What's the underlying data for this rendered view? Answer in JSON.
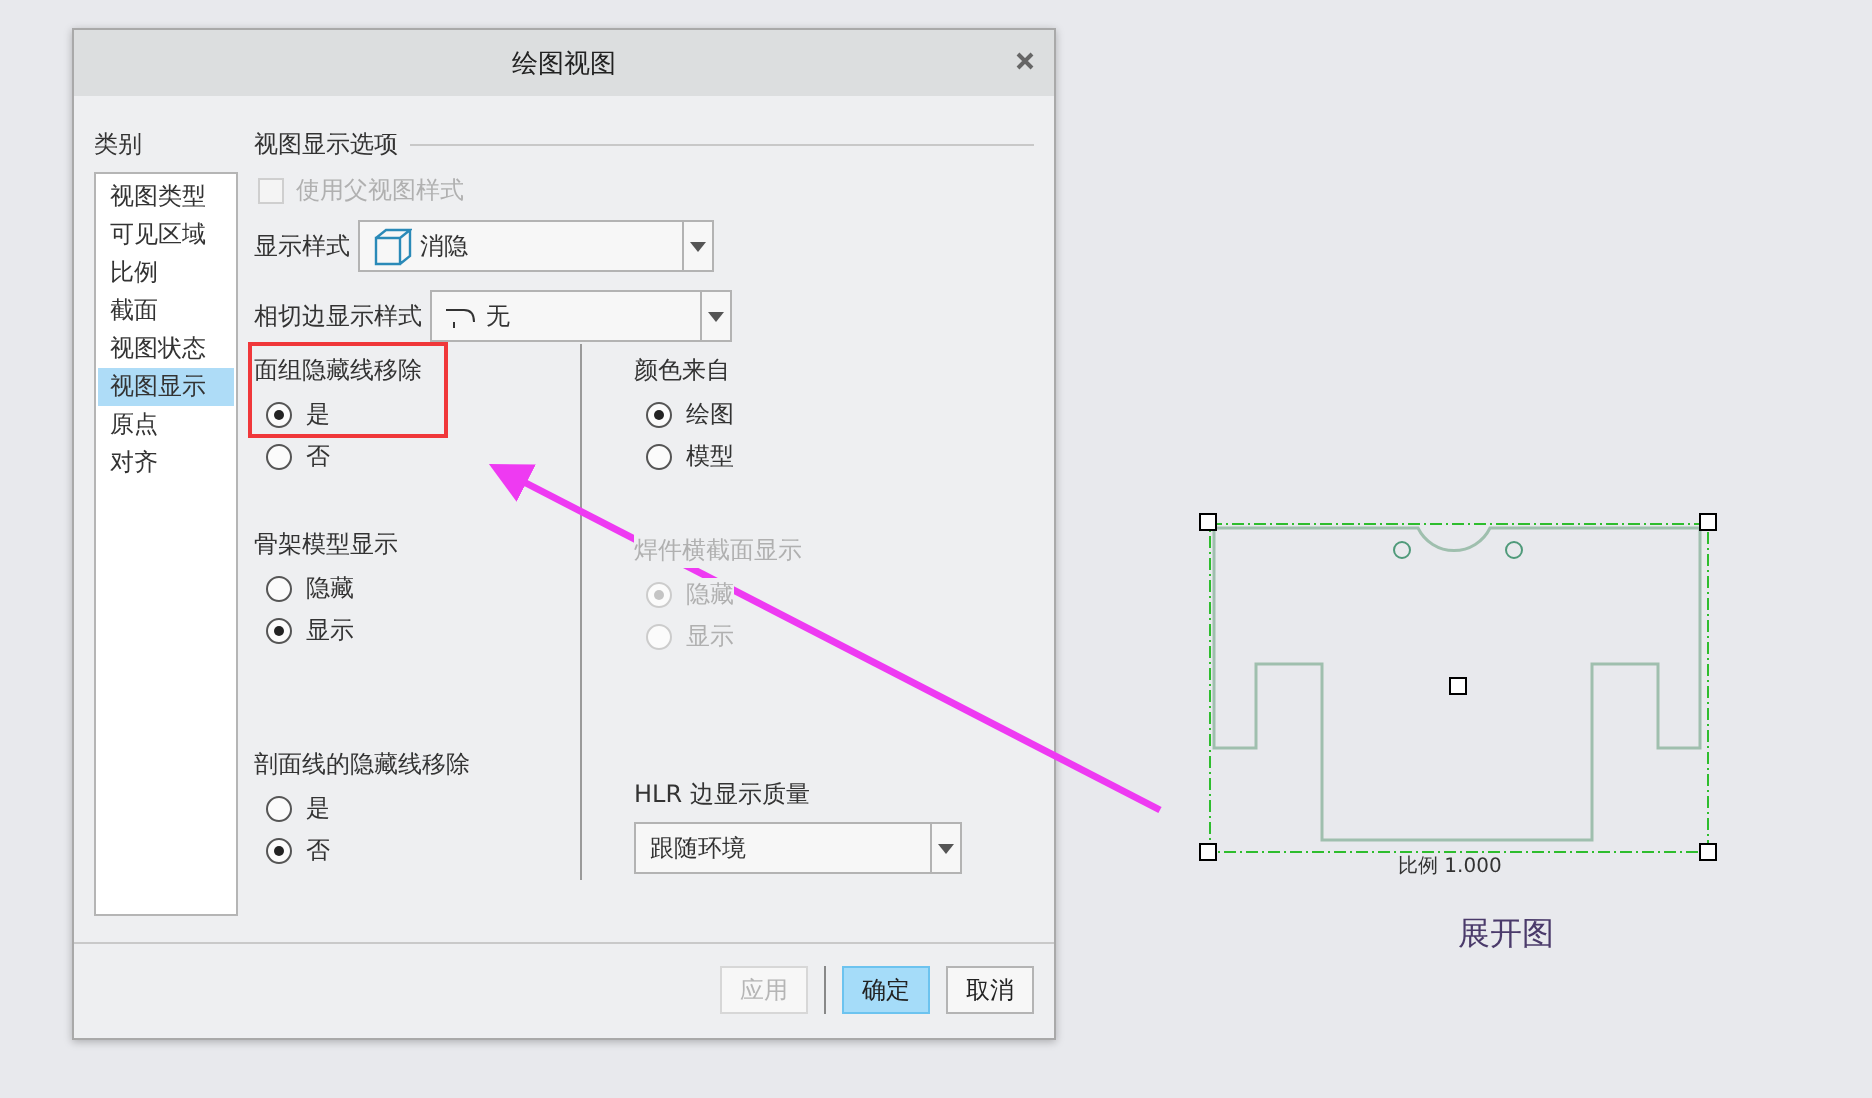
{
  "window": {
    "title": "绘图视图"
  },
  "categories": {
    "title": "类别",
    "items": [
      {
        "label": "视图类型",
        "selected": false
      },
      {
        "label": "可见区域",
        "selected": false
      },
      {
        "label": "比例",
        "selected": false
      },
      {
        "label": "截面",
        "selected": false
      },
      {
        "label": "视图状态",
        "selected": false
      },
      {
        "label": "视图显示",
        "selected": true
      },
      {
        "label": "原点",
        "selected": false
      },
      {
        "label": "对齐",
        "selected": false
      }
    ]
  },
  "options": {
    "title": "视图显示选项",
    "parent_style": {
      "label": "使用父视图样式",
      "checked": false,
      "disabled": true
    },
    "display_style": {
      "label": "显示样式",
      "value": "消隐"
    },
    "tangent_edge": {
      "label": "相切边显示样式",
      "value": "无"
    },
    "left_groups": [
      {
        "title": "面组隐藏线移除",
        "disabled": false,
        "options": [
          {
            "label": "是",
            "selected": true
          },
          {
            "label": "否",
            "selected": false
          }
        ]
      },
      {
        "title": "骨架模型显示",
        "disabled": false,
        "options": [
          {
            "label": "隐藏",
            "selected": false
          },
          {
            "label": "显示",
            "selected": true
          }
        ]
      },
      {
        "title": "剖面线的隐藏线移除",
        "disabled": false,
        "options": [
          {
            "label": "是",
            "selected": false
          },
          {
            "label": "否",
            "selected": true
          }
        ]
      }
    ],
    "right_groups": [
      {
        "title": "颜色来自",
        "disabled": false,
        "options": [
          {
            "label": "绘图",
            "selected": true
          },
          {
            "label": "模型",
            "selected": false
          }
        ]
      },
      {
        "title": "焊件横截面显示",
        "disabled": true,
        "options": [
          {
            "label": "隐藏",
            "selected": true
          },
          {
            "label": "显示",
            "selected": false
          }
        ]
      }
    ],
    "hlr_quality": {
      "label": "HLR 边显示质量",
      "value": "跟随环境"
    }
  },
  "buttons": [
    {
      "label": "应用",
      "kind": "default",
      "disabled": true
    },
    {
      "label": "确定",
      "kind": "primary",
      "disabled": false
    },
    {
      "label": "取消",
      "kind": "default",
      "disabled": false
    }
  ],
  "drawing": {
    "scale": "比例 1.000",
    "caption": "展开图"
  }
}
